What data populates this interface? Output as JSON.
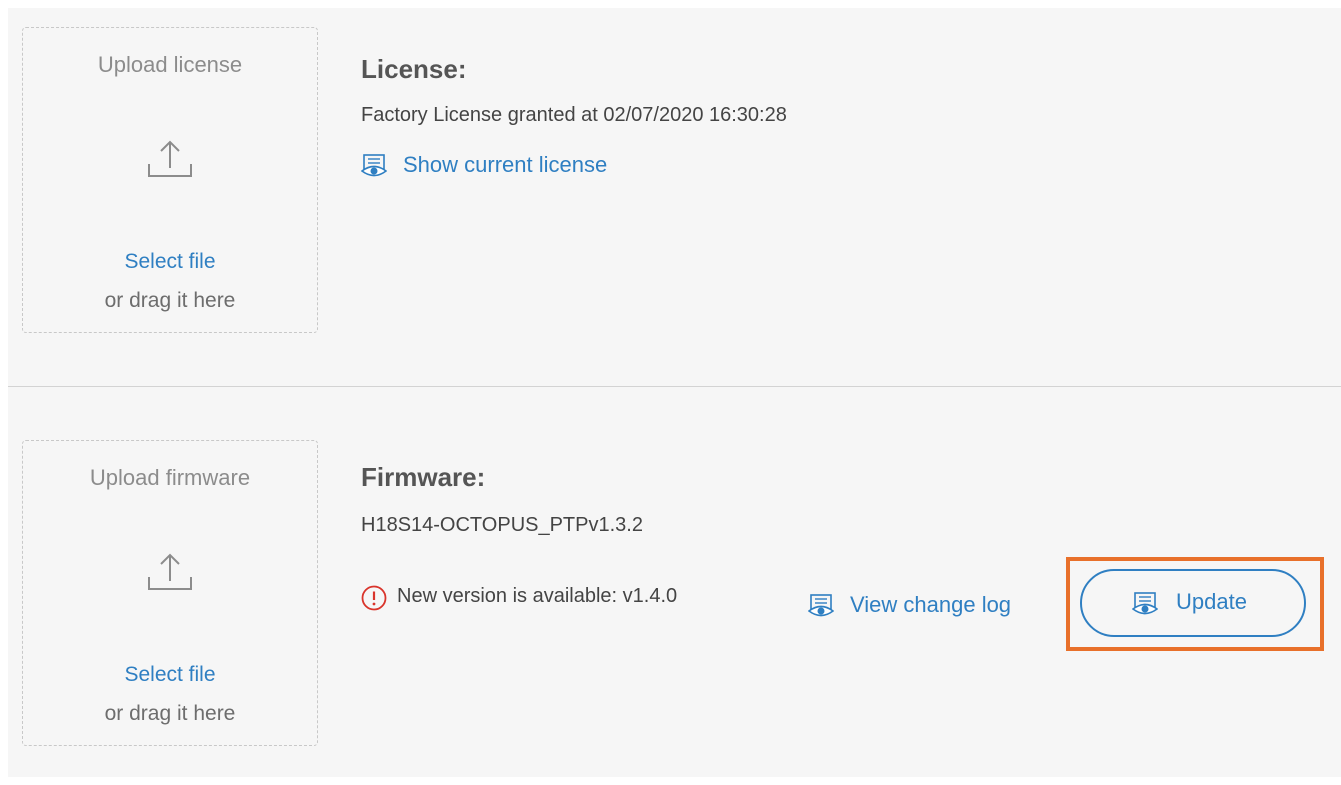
{
  "license": {
    "upload_title": "Upload license",
    "select_file": "Select file",
    "drag_hint": "or drag it here",
    "heading": "License:",
    "info": "Factory License granted at 02/07/2020 16:30:28",
    "show_link": "Show current license"
  },
  "firmware": {
    "upload_title": "Upload firmware",
    "select_file": "Select file",
    "drag_hint": "or drag it here",
    "heading": "Firmware:",
    "version": "H18S14-OCTOPUS_PTPv1.3.2",
    "alert_text": "New version is available: v1.4.0",
    "changelog_link": "View change log",
    "update_label": "Update"
  },
  "icons": {
    "upload": "upload-icon",
    "view": "eye-document-icon",
    "alert": "exclamation-circle-icon"
  },
  "colors": {
    "accent": "#2f7fc2",
    "alert": "#d9342b",
    "highlight": "#e8702a",
    "panel_bg": "#f6f6f6"
  }
}
